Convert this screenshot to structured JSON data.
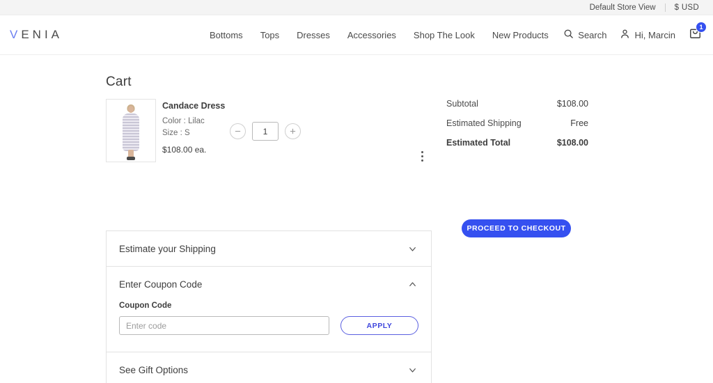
{
  "top_strip": {
    "store_view": "Default Store View",
    "currency": "$  USD"
  },
  "header": {
    "logo_first_letter": "V",
    "logo_rest": "ENIA",
    "nav_items": [
      {
        "label": "Bottoms"
      },
      {
        "label": "Tops"
      },
      {
        "label": "Dresses"
      },
      {
        "label": "Accessories"
      },
      {
        "label": "Shop The Look"
      },
      {
        "label": "New Products"
      }
    ],
    "search_label": "Search",
    "search_icon": "search-icon",
    "account_label": "Hi, Marcin",
    "account_icon": "user-icon",
    "cart_icon": "shopping-bag-icon",
    "cart_count": "1",
    "badge_color": "#3550f0"
  },
  "page": {
    "title": "Cart"
  },
  "cart_item": {
    "name": "Candace Dress",
    "color_option": "Color : Lilac",
    "size_option": "Size : S",
    "unit_price": "$108.00 ea.",
    "quantity": "1",
    "decrement_icon": "minus-circle-icon",
    "increment_icon": "plus-circle-icon",
    "kebab_icon": "more-vertical-icon",
    "thumbnail_alt": "candace-dress-thumbnail"
  },
  "summary": {
    "rows": [
      {
        "label": "Subtotal",
        "value": "$108.00"
      },
      {
        "label": "Estimated Shipping",
        "value": "Free"
      },
      {
        "label": "Estimated Total",
        "value": "$108.00"
      }
    ],
    "checkout_label": "PROCEED TO CHECKOUT",
    "checkout_color": "#3550f0"
  },
  "accordion": {
    "shipping": {
      "title": "Estimate your Shipping",
      "chevron": "chevron-down-icon"
    },
    "coupon": {
      "title": "Enter Coupon Code",
      "chevron": "chevron-up-icon",
      "field_label": "Coupon Code",
      "input_value": "",
      "input_placeholder": "Enter code",
      "apply_label": "APPLY",
      "apply_color": "#3f47dd"
    },
    "gift": {
      "title": "See Gift Options",
      "chevron": "chevron-down-icon"
    }
  }
}
